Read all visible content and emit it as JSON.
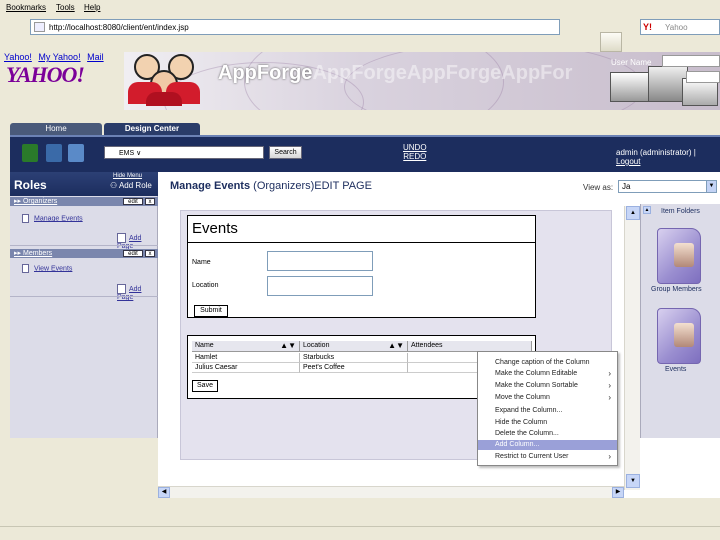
{
  "browser": {
    "menu": [
      "Bookmarks",
      "Tools",
      "Help"
    ],
    "url": "http://localhost:8080/client/ent/index.jsp",
    "search_placeholder": "Yahoo",
    "search_logo": "Y!"
  },
  "yahoo": {
    "links": [
      "Yahoo!",
      "My Yahoo!",
      "Mail"
    ],
    "logo": "YAHOO!"
  },
  "banner": {
    "brand": "AppForge",
    "brand_repeat": "AppForgeAppForgeAppFor",
    "username_label": "User Name"
  },
  "tabs": {
    "home": "Home",
    "design_center": "Design Center"
  },
  "toolbar": {
    "entity_value": "EMS",
    "search_label": "Search",
    "undo": "UNDO",
    "redo": "REDO",
    "user_text": "admin (administrator) |",
    "logout": "Logout"
  },
  "roles": {
    "title": "Roles",
    "hide_menu": "Hide Menu",
    "add_role": "Add Role",
    "edit_label": "edit",
    "delete_label": "x",
    "groups": [
      {
        "name": "Organizers",
        "items": [
          "Manage Events"
        ],
        "add_page": "Add Page"
      },
      {
        "name": "Members",
        "items": [
          "View Events"
        ],
        "add_page": "Add Page"
      }
    ]
  },
  "main": {
    "title": "Manage Events",
    "subtitle": "(Organizers)",
    "edit_page": "EDIT PAGE",
    "view_as_label": "View as:",
    "view_as_value": "Ja"
  },
  "form": {
    "title": "Events",
    "fields": [
      {
        "label": "Name",
        "value": ""
      },
      {
        "label": "Location",
        "value": ""
      }
    ],
    "submit": "Submit"
  },
  "table": {
    "columns": [
      "Name",
      "Location",
      "Attendees"
    ],
    "rows": [
      [
        "Hamlet",
        "Starbucks",
        ""
      ],
      [
        "Julius Caesar",
        "Peet's Coffee",
        ""
      ]
    ],
    "save": "Save"
  },
  "context_menu": {
    "items": [
      {
        "label": "Change caption of the Column",
        "submenu": false,
        "selected": false
      },
      {
        "label": "Make the Column Editable",
        "submenu": true,
        "selected": false
      },
      {
        "label": "Make the Column Sortable",
        "submenu": true,
        "selected": false
      },
      {
        "label": "Move the Column",
        "submenu": true,
        "selected": false
      },
      {
        "label": "Expand the Column...",
        "submenu": false,
        "selected": false
      },
      {
        "label": "Hide the Column",
        "submenu": false,
        "selected": false
      },
      {
        "label": "Delete the Column...",
        "submenu": false,
        "selected": false
      },
      {
        "label": "Add Column...",
        "submenu": false,
        "selected": true
      },
      {
        "label": "Restrict to Current User",
        "submenu": true,
        "selected": false
      }
    ]
  },
  "folders": {
    "title": "Item Folders",
    "items": [
      "Group Members",
      "Events"
    ]
  },
  "colors": {
    "navy": "#1c2d5e",
    "panel": "#dcdce8",
    "menu_selected": "#9aa0d8"
  }
}
